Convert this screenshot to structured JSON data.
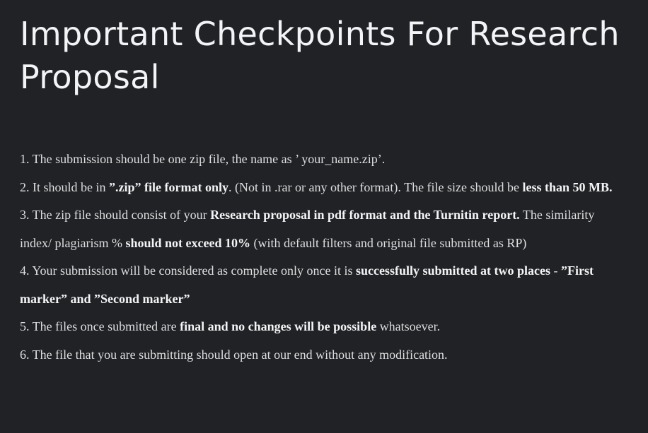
{
  "document": {
    "title": "Important Checkpoints For Research Proposal",
    "items": [
      {
        "segments": [
          {
            "text": "1. The submission should be one zip file, the name as ’ your_name.zip’.",
            "bold": false
          }
        ]
      },
      {
        "segments": [
          {
            "text": "2. It should be in ",
            "bold": false
          },
          {
            "text": "”.zip” file format only",
            "bold": true
          },
          {
            "text": ". (Not in .rar or any other format). The file size should be ",
            "bold": false
          },
          {
            "text": "less than 50 MB.",
            "bold": true
          }
        ]
      },
      {
        "segments": [
          {
            "text": "3. The zip file should consist of your ",
            "bold": false
          },
          {
            "text": "Research proposal in pdf format and the Turnitin report.",
            "bold": true
          },
          {
            "text": " The similarity index/ plagiarism % ",
            "bold": false
          },
          {
            "text": "should not exceed 10%",
            "bold": true
          },
          {
            "text": " (with default filters and original file submitted as RP)",
            "bold": false
          }
        ]
      },
      {
        "segments": [
          {
            "text": "4. Your submission will be considered as complete only once it is ",
            "bold": false
          },
          {
            "text": "successfully submitted at two places",
            "bold": true
          },
          {
            "text": " - ",
            "bold": false
          },
          {
            "text": "”First marker” and ”Second marker”",
            "bold": true
          }
        ]
      },
      {
        "segments": [
          {
            "text": "5. The files once submitted are ",
            "bold": false
          },
          {
            "text": "final and no changes will be possible",
            "bold": true
          },
          {
            "text": " whatsoever.",
            "bold": false
          }
        ]
      },
      {
        "segments": [
          {
            "text": "6. The file that you are submitting should open at our end without any modification.",
            "bold": false
          }
        ]
      }
    ]
  }
}
